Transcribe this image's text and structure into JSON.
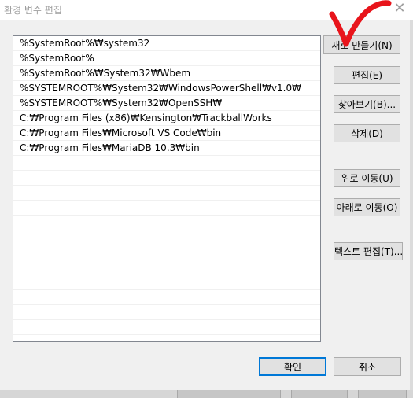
{
  "window": {
    "title": "환경 변수 편집",
    "close_glyph": "✕"
  },
  "paths": [
    "%SystemRoot%₩system32",
    "%SystemRoot%",
    "%SystemRoot%₩System32₩Wbem",
    "%SYSTEMROOT%₩System32₩WindowsPowerShell₩v1.0₩",
    "%SYSTEMROOT%₩System32₩OpenSSH₩",
    "C:₩Program Files (x86)₩Kensington₩TrackballWorks",
    "C:₩Program Files₩Microsoft VS Code₩bin",
    "C:₩Program Files₩MariaDB 10.3₩bin"
  ],
  "empty_rows": 12,
  "buttons": {
    "new": "새로 만들기(N)",
    "edit": "편집(E)",
    "browse": "찾아보기(B)...",
    "delete": "삭제(D)",
    "move_up": "위로 이동(U)",
    "move_down": "아래로 이동(O)",
    "edit_text": "텍스트 편집(T)..."
  },
  "footer": {
    "ok": "확인",
    "cancel": "취소"
  },
  "colors": {
    "annotation": "#e8141b",
    "default_button_border": "#0078d7"
  }
}
